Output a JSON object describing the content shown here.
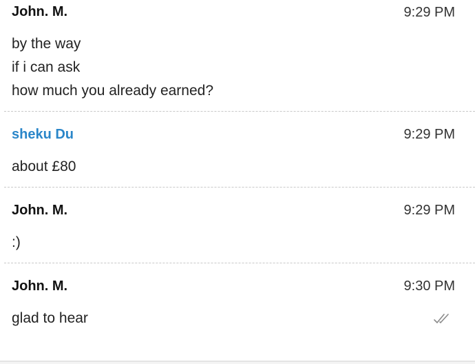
{
  "messages": [
    {
      "sender": "John. M.",
      "time": "9:29 PM",
      "lines": [
        "by the way",
        "if i can ask",
        "how much you already earned?"
      ]
    },
    {
      "sender": "sheku Du",
      "time": "9:29 PM",
      "lines": [
        "about £80"
      ]
    },
    {
      "sender": "John. M.",
      "time": "9:29 PM",
      "lines": [
        ":)"
      ]
    },
    {
      "sender": "John. M.",
      "time": "9:30 PM",
      "lines": [
        "glad to hear"
      ],
      "status_icon": "double-check-icon"
    }
  ],
  "colors": {
    "own_sender": "#111111",
    "other_sender": "#2a86c9",
    "divider": "#c8c8c8",
    "read_check": "#8a8a8a"
  }
}
